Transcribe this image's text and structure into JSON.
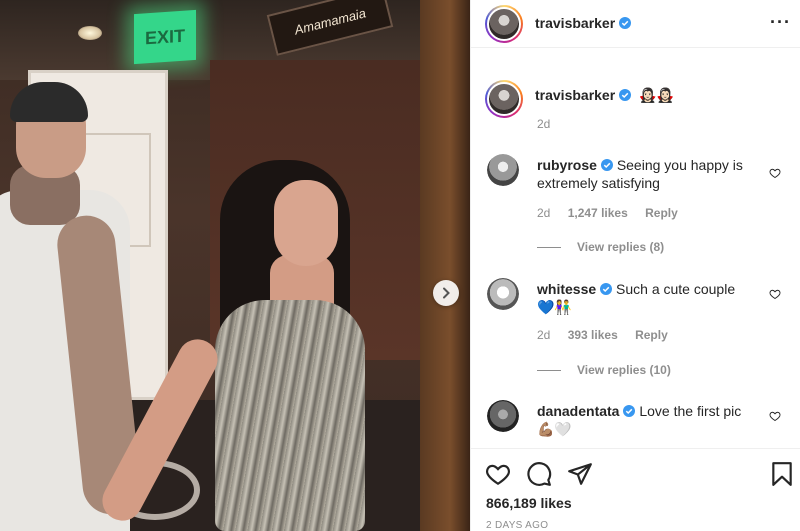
{
  "post": {
    "author": "travisbarker",
    "caption_emoji": "🧛🏻‍♀️🧛🏻‍♀️",
    "caption_age": "2d",
    "likes": "866,189 likes",
    "timestamp": "2 DAYS AGO"
  },
  "photo": {
    "exit_sign": "EXIT",
    "neon_sign": "Amamamaia"
  },
  "comments": [
    {
      "user": "rubyrose",
      "text": "Seeing you happy is extremely satisfying",
      "age": "2d",
      "likes": "1,247 likes",
      "reply": "Reply",
      "view_replies": "View replies (8)"
    },
    {
      "user": "whitesse",
      "text": "Such a cute couple",
      "emoji": "💙👫",
      "age": "2d",
      "likes": "393 likes",
      "reply": "Reply",
      "view_replies": "View replies (10)"
    },
    {
      "user": "danadentata",
      "text": "Love the first pic",
      "emoji": "💪🏽🤍"
    }
  ],
  "icons": {
    "like": "heart-icon",
    "comment": "comment-icon",
    "share": "share-icon",
    "save": "bookmark-icon",
    "verified": "verified-badge-icon",
    "more": "more-options-icon",
    "next": "chevron-right-icon"
  },
  "colors": {
    "verified": "#3897f0",
    "text": "#262626",
    "muted": "#8e8e8e",
    "divider": "#efefef"
  }
}
